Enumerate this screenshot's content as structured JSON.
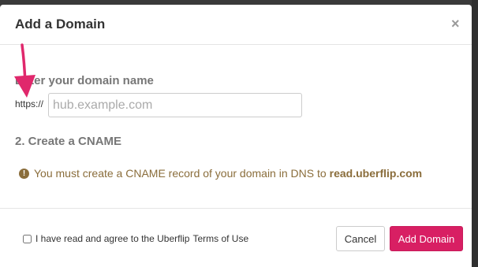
{
  "modal": {
    "title": "Add a Domain",
    "close_glyph": "×"
  },
  "step1": {
    "title": "Enter your domain name",
    "prefix": "https://",
    "input_value": "",
    "input_placeholder": "hub.example.com"
  },
  "step2": {
    "title": "2. Create a CNAME",
    "warning_icon": "exclamation-circle-icon",
    "warning_text": "You must create a CNAME record of your domain in DNS to",
    "cname_target": "read.uberflip.com"
  },
  "footer": {
    "agree_text": "I have read and agree to the Uberflip",
    "terms_link": "Terms of Use",
    "agree_checked": false,
    "cancel_label": "Cancel",
    "submit_label": "Add Domain"
  },
  "colors": {
    "accent": "#d81f63",
    "warning": "#8a6d3b",
    "annotation_arrow": "#e0286c"
  }
}
